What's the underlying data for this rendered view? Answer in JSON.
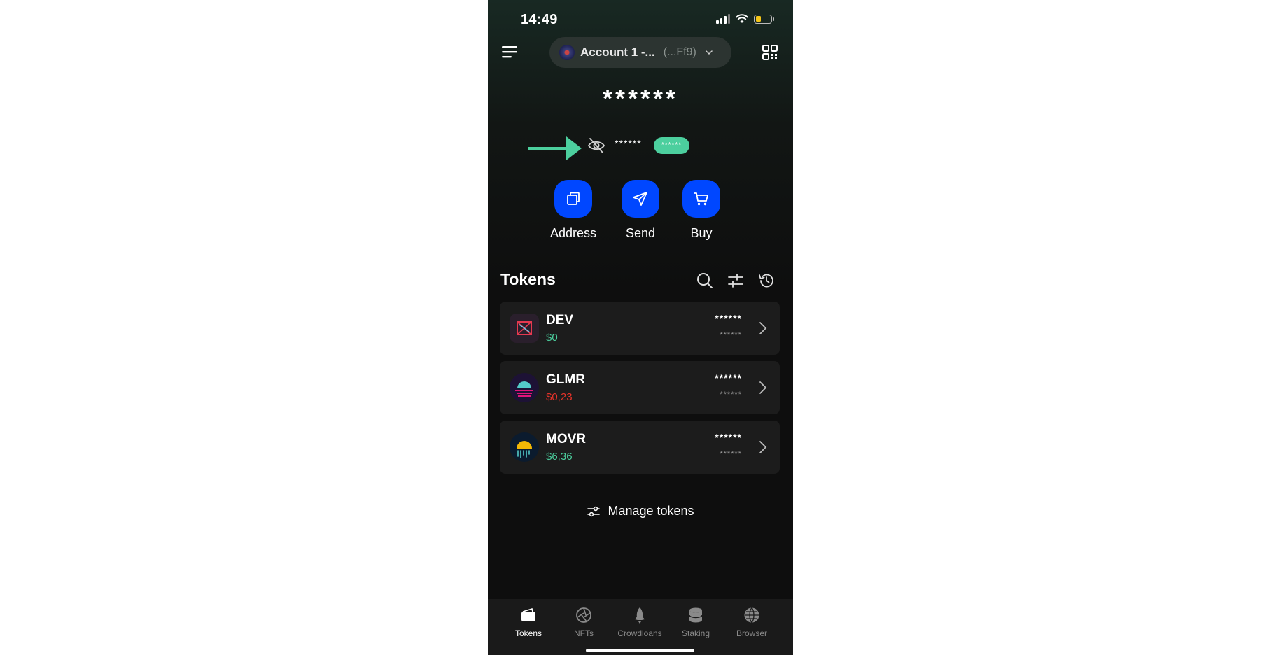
{
  "status_bar": {
    "time": "14:49"
  },
  "header": {
    "account_name": "Account 1 -...",
    "account_address": "(...Ff9)",
    "menu_icon": "hamburger-menu-icon",
    "qr_icon": "qr-code-icon"
  },
  "balance": {
    "total": "******",
    "sub_value": "******",
    "change_pill": "******",
    "visibility_icon": "eye-slash-icon",
    "arrow_color": "#4ccf9e"
  },
  "actions": [
    {
      "label": "Address",
      "icon": "copy-icon"
    },
    {
      "label": "Send",
      "icon": "send-icon"
    },
    {
      "label": "Buy",
      "icon": "cart-icon"
    }
  ],
  "tokens_section": {
    "title": "Tokens",
    "tools": [
      "search-icon",
      "filter-icon",
      "history-icon"
    ],
    "items": [
      {
        "symbol": "DEV",
        "price": "$0",
        "price_color": "#4ccf9e",
        "amount": "******",
        "value": "******"
      },
      {
        "symbol": "GLMR",
        "price": "$0,23",
        "price_color": "#e5332a",
        "amount": "******",
        "value": "******"
      },
      {
        "symbol": "MOVR",
        "price": "$6,36",
        "price_color": "#4ccf9e",
        "amount": "******",
        "value": "******"
      }
    ],
    "manage_label": "Manage tokens"
  },
  "tab_bar": {
    "tabs": [
      {
        "label": "Tokens",
        "icon": "wallet-icon",
        "active": true
      },
      {
        "label": "NFTs",
        "icon": "aperture-icon",
        "active": false
      },
      {
        "label": "Crowdloans",
        "icon": "rocket-icon",
        "active": false
      },
      {
        "label": "Staking",
        "icon": "coins-stack-icon",
        "active": false
      },
      {
        "label": "Browser",
        "icon": "globe-icon",
        "active": false
      }
    ]
  },
  "colors": {
    "accent_blue": "#0047ff",
    "accent_green": "#4ccf9e",
    "negative_red": "#e5332a"
  }
}
